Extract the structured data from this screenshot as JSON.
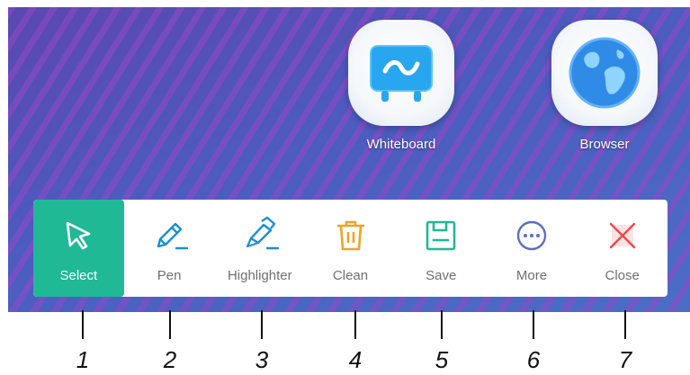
{
  "desktop": {
    "apps": [
      {
        "label": "Whiteboard",
        "icon": "whiteboard-icon"
      },
      {
        "label": "Browser",
        "icon": "globe-icon"
      }
    ]
  },
  "toolbar": {
    "active_tool": "Select",
    "accent_color": "#1fb996",
    "tools": [
      {
        "label": "Select",
        "icon": "cursor-arrow-icon"
      },
      {
        "label": "Pen",
        "icon": "pen-icon"
      },
      {
        "label": "Highlighter",
        "icon": "highlighter-icon"
      },
      {
        "label": "Clean",
        "icon": "trash-icon"
      },
      {
        "label": "Save",
        "icon": "save-icon"
      },
      {
        "label": "More",
        "icon": "more-icon"
      },
      {
        "label": "Close",
        "icon": "close-icon"
      }
    ]
  },
  "callouts": [
    "1",
    "2",
    "3",
    "4",
    "5",
    "6",
    "7"
  ]
}
